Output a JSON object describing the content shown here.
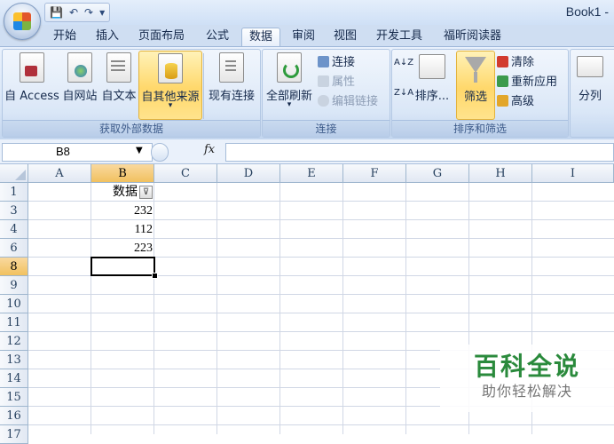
{
  "window": {
    "title": "Book1 -"
  },
  "quick_access": {
    "save": "💾",
    "undo": "↶",
    "redo": "↷",
    "customize": "▾"
  },
  "tabs": [
    {
      "label": "开始"
    },
    {
      "label": "插入"
    },
    {
      "label": "页面布局"
    },
    {
      "label": "公式"
    },
    {
      "label": "数据",
      "active": true
    },
    {
      "label": "审阅"
    },
    {
      "label": "视图"
    },
    {
      "label": "开发工具"
    },
    {
      "label": "福昕阅读器"
    }
  ],
  "ribbon": {
    "get_external": {
      "group_label": "获取外部数据",
      "access": "自 Access",
      "web": "自网站",
      "text": "自文本",
      "other": "自其他来源",
      "other_arrow": "▾",
      "existing": "现有连接"
    },
    "connections": {
      "group_label": "连接",
      "refresh_all": "全部刷新",
      "refresh_arrow": "▾",
      "connections": "连接",
      "properties": "属性",
      "edit_links": "编辑链接"
    },
    "sort_filter": {
      "group_label": "排序和筛选",
      "sort_az": "A↓Z",
      "sort_za": "Z↓A",
      "sort": "排序...",
      "filter": "筛选",
      "clear": "清除",
      "reapply": "重新应用",
      "advanced": "高级"
    },
    "data_tools": {
      "text_to_columns": "分列"
    }
  },
  "formula_bar": {
    "name_box": "B8",
    "fx": "fx",
    "value": ""
  },
  "columns": [
    "A",
    "B",
    "C",
    "D",
    "E",
    "F",
    "G",
    "H",
    "I"
  ],
  "rows": [
    "1",
    "3",
    "4",
    "6",
    "8",
    "9",
    "10",
    "11",
    "12",
    "13",
    "14",
    "15",
    "16",
    "17"
  ],
  "cells": {
    "B1": "数据",
    "B3": "232",
    "B4": "112",
    "B6": "223"
  },
  "selected_cell": "B8",
  "watermark": {
    "line1": "百科全说",
    "line2": "助你轻松解决"
  }
}
